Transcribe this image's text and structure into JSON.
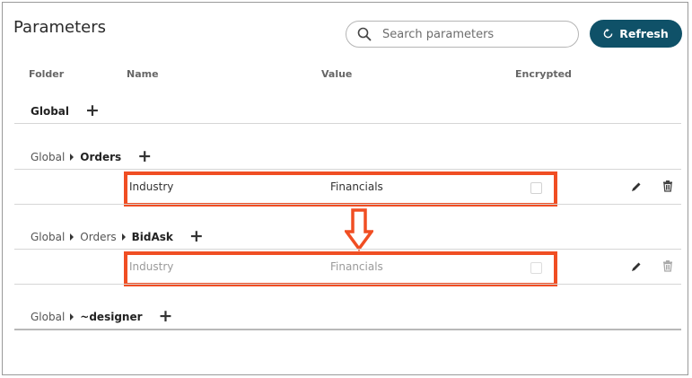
{
  "page": {
    "title": "Parameters"
  },
  "search": {
    "placeholder": "Search parameters",
    "icon": "search-icon"
  },
  "toolbar": {
    "refresh_label": "Refresh",
    "refresh_icon": "refresh-icon"
  },
  "columns": {
    "folder": "Folder",
    "name": "Name",
    "value": "Value",
    "encrypted": "Encrypted"
  },
  "groups": [
    {
      "path": [],
      "current": "Global",
      "add": "+"
    },
    {
      "path": [
        "Global"
      ],
      "current": "Orders",
      "add": "+",
      "rows": [
        {
          "name": "Industry",
          "value": "Financials",
          "encrypted": false
        }
      ]
    },
    {
      "path": [
        "Global",
        "Orders"
      ],
      "current": "BidAsk",
      "add": "+",
      "rows": [
        {
          "name": "Industry",
          "value": "Financials",
          "encrypted": false,
          "inherited": true
        }
      ]
    },
    {
      "path": [
        "Global"
      ],
      "current": "~designer",
      "add": "+"
    }
  ],
  "colors": {
    "accent": "#0f5168",
    "highlight": "#f04e23",
    "muted_text": "#9a9a9a"
  }
}
